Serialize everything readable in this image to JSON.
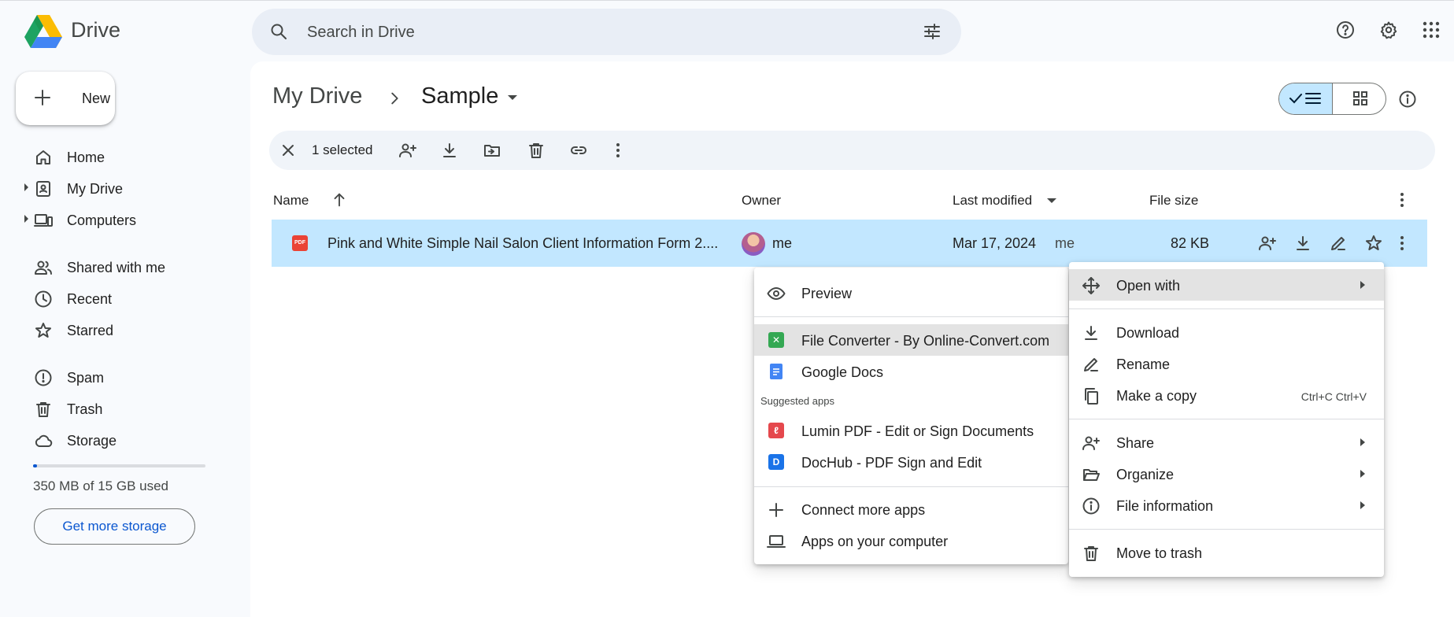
{
  "app": {
    "brand": "Drive"
  },
  "search": {
    "placeholder": "Search in Drive"
  },
  "sidebar": {
    "new_label": "New",
    "items": [
      {
        "label": "Home"
      },
      {
        "label": "My Drive"
      },
      {
        "label": "Computers"
      },
      {
        "label": "Shared with me"
      },
      {
        "label": "Recent"
      },
      {
        "label": "Starred"
      },
      {
        "label": "Spam"
      },
      {
        "label": "Trash"
      },
      {
        "label": "Storage"
      }
    ],
    "storage_used_fraction": 0.023,
    "storage_text": "350 MB of 15 GB used",
    "get_storage_label": "Get more storage"
  },
  "breadcrumb": {
    "root": "My Drive",
    "current": "Sample"
  },
  "actionbar": {
    "selected_text": "1 selected"
  },
  "columns": {
    "name": "Name",
    "owner": "Owner",
    "modified": "Last modified",
    "size": "File size"
  },
  "files": [
    {
      "name": "Pink and White Simple Nail Salon Client Information Form 2....",
      "owner": "me",
      "modified": "Mar 17, 2024",
      "modified_by": "me",
      "size": "82 KB",
      "type_badge": "PDF"
    }
  ],
  "open_with_menu": {
    "preview": "Preview",
    "apps": [
      {
        "label": "File Converter - By Online-Convert.com",
        "icon_color": "#34a853"
      },
      {
        "label": "Google Docs",
        "icon_color": "#4285f4"
      }
    ],
    "suggested_heading": "Suggested apps",
    "suggested": [
      {
        "label": "Lumin PDF - Edit or Sign Documents",
        "icon_color": "#e5484d"
      },
      {
        "label": "DocHub - PDF Sign and Edit",
        "icon_color": "#1a73e8",
        "letter": "D"
      }
    ],
    "connect": "Connect more apps",
    "computer": "Apps on your computer"
  },
  "context_menu": {
    "open_with": "Open with",
    "download": "Download",
    "rename": "Rename",
    "make_copy": "Make a copy",
    "make_copy_shortcut": "Ctrl+C Ctrl+V",
    "share": "Share",
    "organize": "Organize",
    "file_info": "File information",
    "trash": "Move to trash"
  },
  "colors": {
    "accent": "#0b57d0",
    "selection": "#c2e7ff",
    "search_bg": "#e9eef6"
  }
}
